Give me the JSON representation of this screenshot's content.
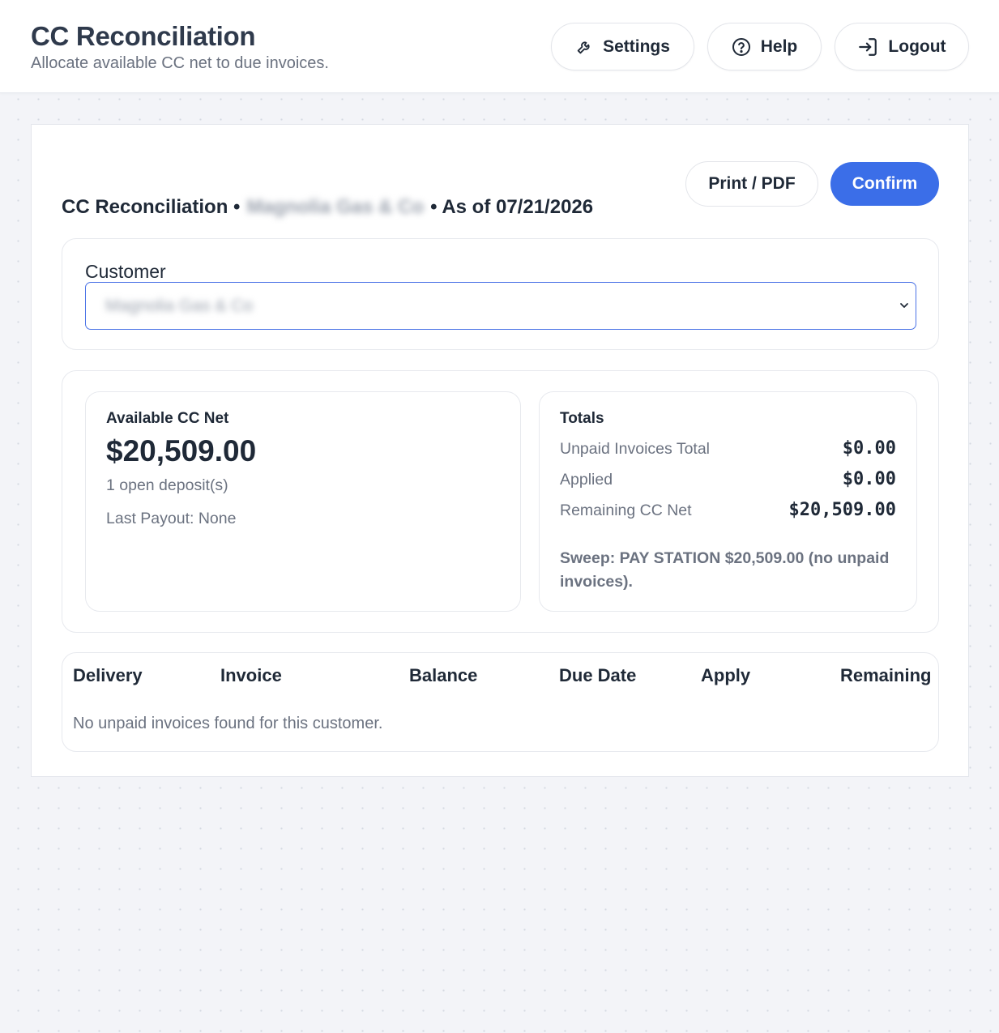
{
  "header": {
    "title": "CC Reconciliation",
    "subtitle": "Allocate available CC net to due invoices.",
    "settings_label": "Settings",
    "help_label": "Help",
    "logout_label": "Logout"
  },
  "actions": {
    "print_label": "Print / PDF",
    "confirm_label": "Confirm"
  },
  "heading": {
    "prefix": "CC Reconciliation •",
    "customer_name": "Magnolia Gas & Co",
    "suffix": "• As of 07/21/2026"
  },
  "customer": {
    "label": "Customer",
    "selected": "Magnolia Gas & Co"
  },
  "available": {
    "label": "Available CC Net",
    "amount": "$20,509.00",
    "open_deposits": "1 open deposit(s)",
    "last_payout": "Last Payout: None"
  },
  "totals": {
    "label": "Totals",
    "rows": [
      {
        "label": "Unpaid Invoices Total",
        "value": "$0.00"
      },
      {
        "label": "Applied",
        "value": "$0.00"
      },
      {
        "label": "Remaining CC Net",
        "value": "$20,509.00"
      }
    ],
    "sweep_note": "Sweep: PAY STATION $20,509.00 (no unpaid invoices)."
  },
  "table": {
    "columns": [
      "Delivery",
      "Invoice",
      "Balance",
      "Due Date",
      "Apply",
      "Remaining"
    ],
    "empty_message": "No unpaid invoices found for this customer."
  }
}
